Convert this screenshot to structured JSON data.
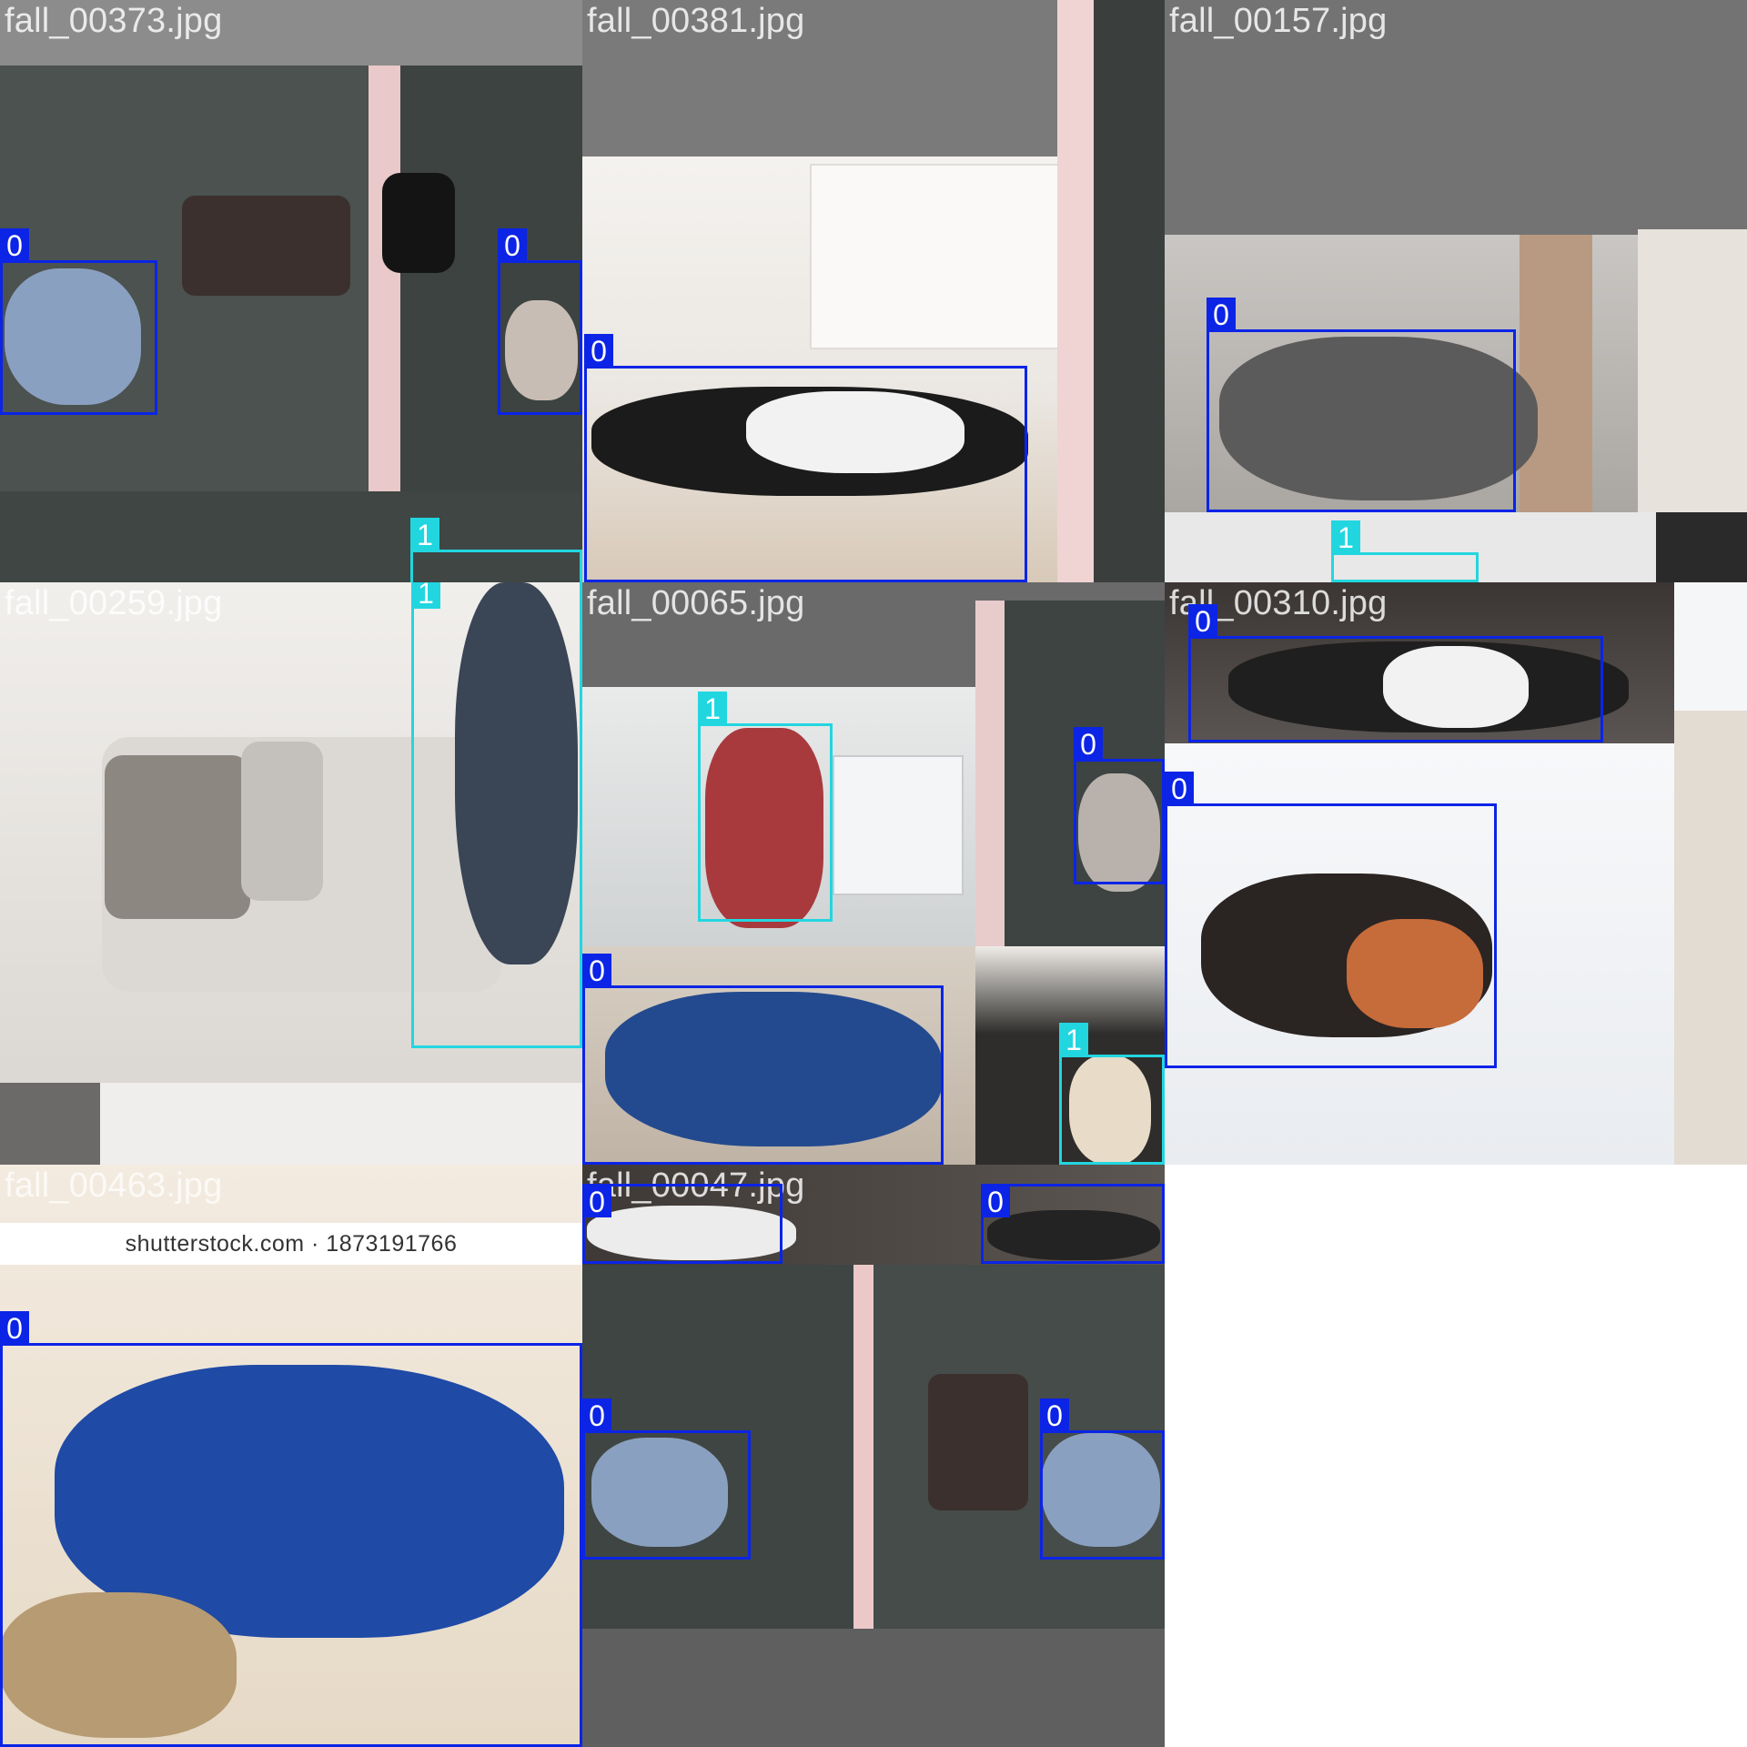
{
  "grid": {
    "filenames": [
      "fall_00373.jpg",
      "fall_00381.jpg",
      "fall_00157.jpg",
      "fall_00259.jpg",
      "fall_00065.jpg",
      "fall_00310.jpg",
      "fall_00463.jpg",
      "fall_00047.jpg"
    ],
    "watermark": "shutterstock.com · 1873191766"
  },
  "class_labels": {
    "fall": "0",
    "person": "1"
  },
  "colors": {
    "class_0_box": "#0b24e6",
    "class_1_box": "#22d6e0",
    "filename_text": "#ffffff"
  }
}
